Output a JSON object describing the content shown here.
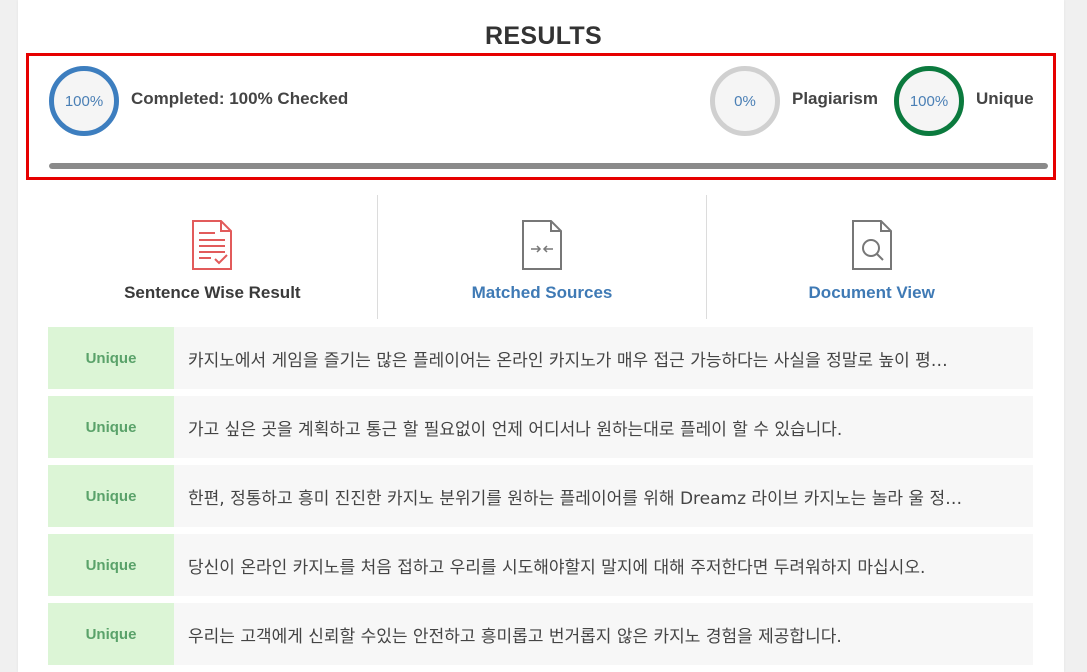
{
  "results": {
    "title": "RESULTS",
    "completed": {
      "percent_text": "100%",
      "label": "Completed: 100% Checked",
      "progress_fraction": 1.0
    },
    "plagiarism": {
      "percent_text": "0%",
      "label": "Plagiarism"
    },
    "unique": {
      "percent_text": "100%",
      "label": "Unique"
    }
  },
  "tabs": [
    {
      "label": "Sentence Wise Result",
      "icon": "report-document-icon"
    },
    {
      "label": "Matched Sources",
      "icon": "compare-document-icon"
    },
    {
      "label": "Document View",
      "icon": "search-document-icon"
    }
  ],
  "sentences": [
    {
      "status": "Unique",
      "text": "카지노에서 게임을 즐기는 많은 플레이어는 온라인 카지노가 매우 접근 가능하다는 사실을 정말로 높이 평…"
    },
    {
      "status": "Unique",
      "text": "가고 싶은 곳을 계획하고 통근 할 필요없이 언제 어디서나 원하는대로 플레이 할 수 있습니다."
    },
    {
      "status": "Unique",
      "text": "한편, 정통하고 흥미 진진한 카지노 분위기를 원하는 플레이어를 위해 Dreamz 라이브 카지노는 놀라 울 정…"
    },
    {
      "status": "Unique",
      "text": "당신이 온라인 카지노를 처음 접하고 우리를 시도해야할지 말지에 대해 주저한다면 두려워하지 마십시오."
    },
    {
      "status": "Unique",
      "text": "우리는 고객에게 신뢰할 수있는 안전하고 흥미롭고 번거롭지 않은 카지노 경험을 제공합니다."
    }
  ],
  "colors": {
    "highlight_border": "#e60000",
    "completed_ring": "#3d7ebf",
    "plagiarism_ring": "#d0d0d0",
    "unique_ring": "#0b7a3e",
    "unique_badge_bg": "#dcf5d6",
    "tab_active_text": "#3a3a3a",
    "tab_link_text": "#3f7ab5"
  }
}
